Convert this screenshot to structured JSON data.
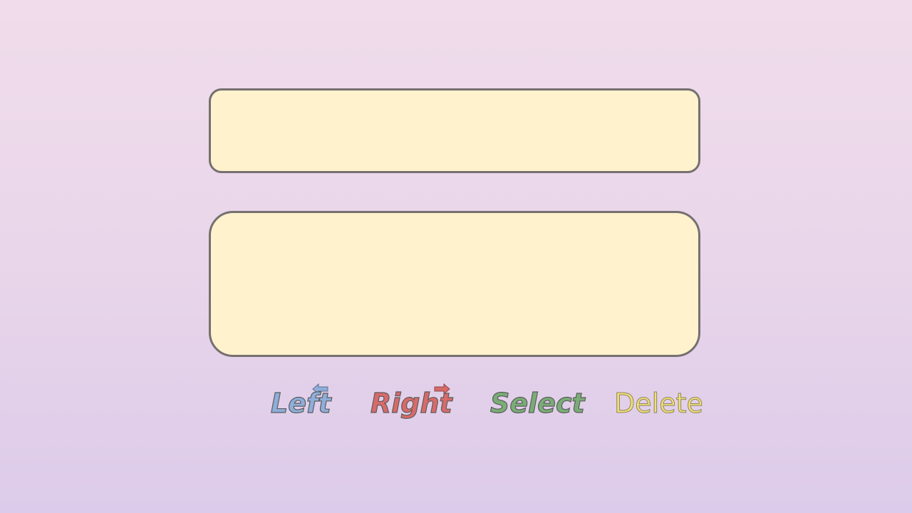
{
  "panels": {
    "top": {
      "text": ""
    },
    "bottom": {
      "text": ""
    }
  },
  "controls": {
    "left": {
      "label": "Left",
      "icon": "arrow-left-icon",
      "color": "#8eaedb"
    },
    "right": {
      "label": "Right",
      "icon": "arrow-right-icon",
      "color": "#d86a6a"
    },
    "select": {
      "label": "Select",
      "color": "#79ad76"
    },
    "delete": {
      "label": "Delete",
      "color": "#f5dd74"
    }
  },
  "colors": {
    "panel_fill": "#fff2cc",
    "panel_border": "#767070",
    "background_top": "#f0dcea",
    "background_bottom": "#dccbea"
  }
}
